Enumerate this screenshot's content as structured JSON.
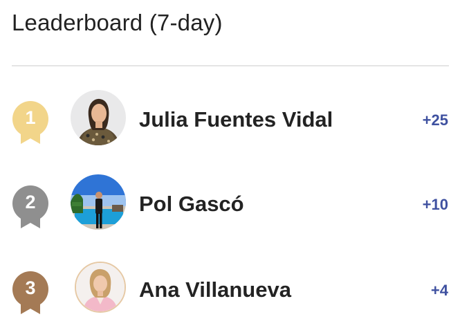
{
  "leaderboard": {
    "title": "Leaderboard (7-day)",
    "entries": [
      {
        "rank": "1",
        "name": "Julia Fuentes Vidal",
        "points": "+25",
        "medal_color": "#f2d58a"
      },
      {
        "rank": "2",
        "name": "Pol Gascó",
        "points": "+10",
        "medal_color": "#8f8f8f"
      },
      {
        "rank": "3",
        "name": "Ana Villanueva",
        "points": "+4",
        "medal_color": "#a47a55"
      }
    ]
  },
  "colors": {
    "points": "#3f51a0",
    "divider": "#e4e4e4"
  },
  "icons": {
    "medal": "ribbon-medal-icon",
    "avatar": "user-avatar"
  }
}
